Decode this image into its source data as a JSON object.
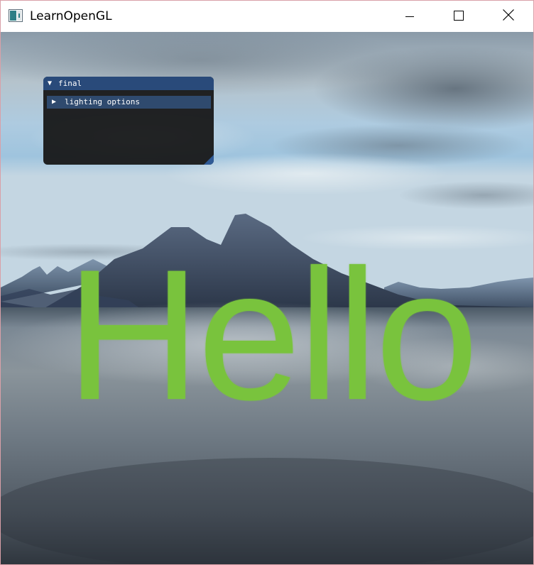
{
  "window": {
    "title": "LearnOpenGL",
    "icon": "app-icon",
    "buttons": [
      "minimize-icon",
      "maximize-icon",
      "close-icon"
    ]
  },
  "scene": {
    "text": "Hello",
    "text_color": "#79c33d",
    "background": "skybox with mountains and water"
  },
  "imgui": {
    "title": "final",
    "collapse_icon": "triangle-down-icon",
    "header_icon": "triangle-right-icon",
    "header_label": "lighting options",
    "title_color": "#294a7a",
    "header_color": "#2f4a6e"
  }
}
